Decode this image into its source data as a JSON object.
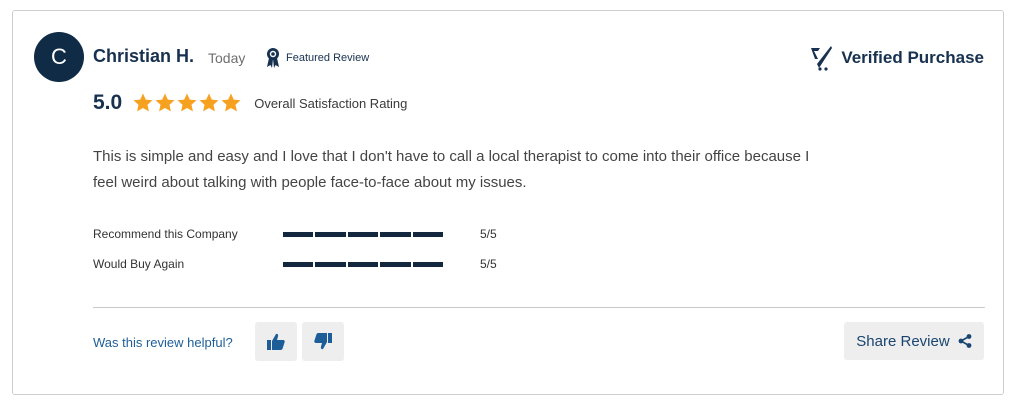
{
  "review": {
    "avatar_initial": "C",
    "author": "Christian H.",
    "date": "Today",
    "featured_label": "Featured Review",
    "verified_label": "Verified Purchase",
    "score": "5.0",
    "stars": 5,
    "rating_label": "Overall Satisfaction Rating",
    "text": "This is simple and easy and I love that I don't have to call a local therapist to come into their office because I feel weird about talking with people face-to-face about my issues.",
    "metrics": [
      {
        "label": "Recommend this Company",
        "value": "5/5",
        "score": 5,
        "max": 5
      },
      {
        "label": "Would Buy Again",
        "value": "5/5",
        "score": 5,
        "max": 5
      }
    ],
    "helpful_label": "Was this review helpful?",
    "share_label": "Share Review"
  },
  "colors": {
    "navy": "#0f2b45",
    "star": "#f7a121",
    "link": "#1d5e98"
  },
  "icons": {
    "featured": "award-ribbon-icon",
    "verified": "verified-check-icon",
    "thumbs_up": "thumbs-up-icon",
    "thumbs_down": "thumbs-down-icon",
    "share": "share-icon"
  }
}
